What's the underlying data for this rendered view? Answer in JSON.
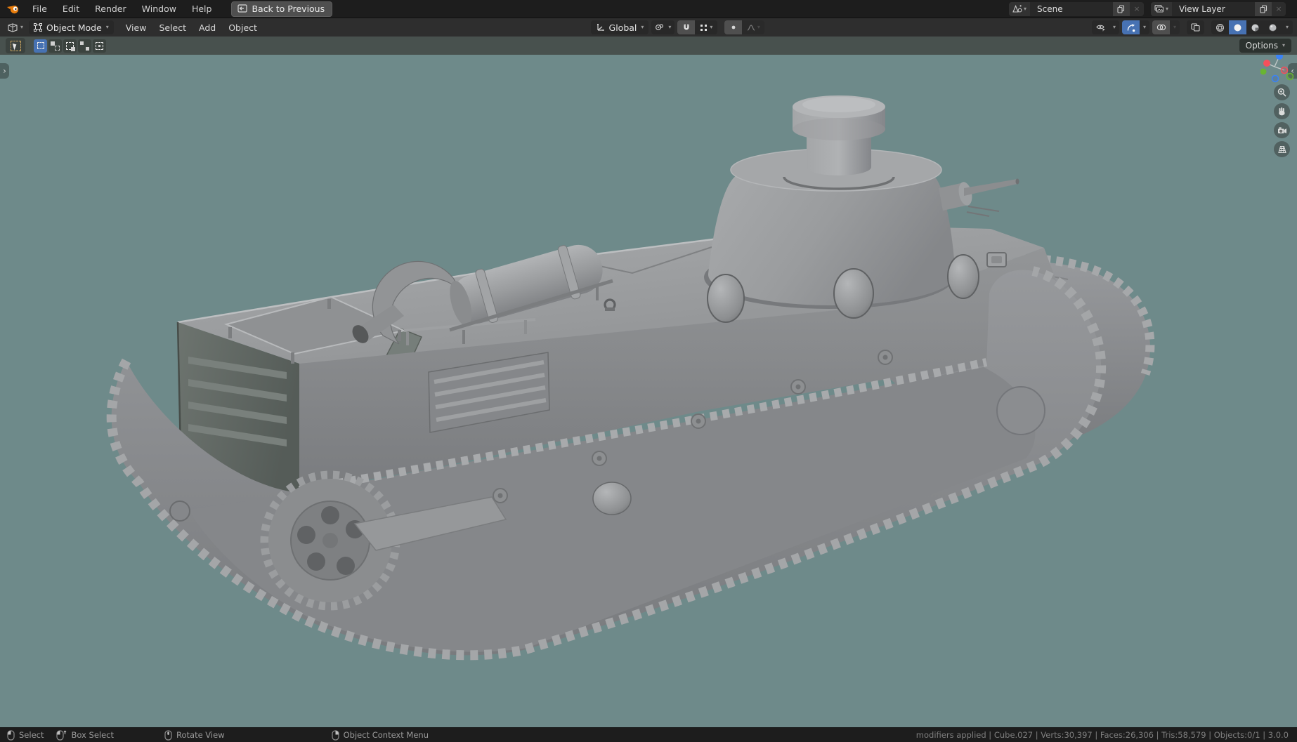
{
  "app": {
    "name": "Blender 3D Viewport"
  },
  "colors": {
    "accent": "#4772b3",
    "viewport_bg": "#6e8a8a",
    "topbar_bg": "#1d1d1d",
    "header_bg": "#2e2e2e",
    "tool_header_bg": "#48514e",
    "statusbar_bg": "#1d1d1d"
  },
  "icons": {
    "chevron_down": "▾",
    "close": "×",
    "collapse_left": "‹",
    "expand_right": "›"
  },
  "topbar": {
    "menus": [
      {
        "label": "File"
      },
      {
        "label": "Edit"
      },
      {
        "label": "Render"
      },
      {
        "label": "Window"
      },
      {
        "label": "Help"
      }
    ],
    "back_button_label": "Back to Previous",
    "scene_selector": {
      "value": "Scene"
    },
    "view_layer_selector": {
      "value": "View Layer"
    }
  },
  "viewport_header": {
    "mode_select": {
      "value": "Object Mode"
    },
    "menus": [
      {
        "label": "View"
      },
      {
        "label": "Select"
      },
      {
        "label": "Add"
      },
      {
        "label": "Object"
      }
    ],
    "transform_orientation": {
      "value": "Global"
    }
  },
  "tool_header": {
    "options_label": "Options"
  },
  "viewport": {
    "object": "WWI-style tank 3D model, solid shading"
  },
  "statusbar": {
    "hints": [
      {
        "icon": "mouse-left-icon",
        "label": "Select"
      },
      {
        "icon": "mouse-left-drag-icon",
        "label": "Box Select"
      },
      {
        "icon": "mouse-middle-icon",
        "label": "Rotate View"
      },
      {
        "icon": "mouse-right-icon",
        "label": "Object Context Menu"
      }
    ],
    "stats": "modifiers applied | Cube.027 | Verts:30,397 | Faces:26,306 | Tris:58,579 | Objects:0/1 | 3.0.0"
  }
}
